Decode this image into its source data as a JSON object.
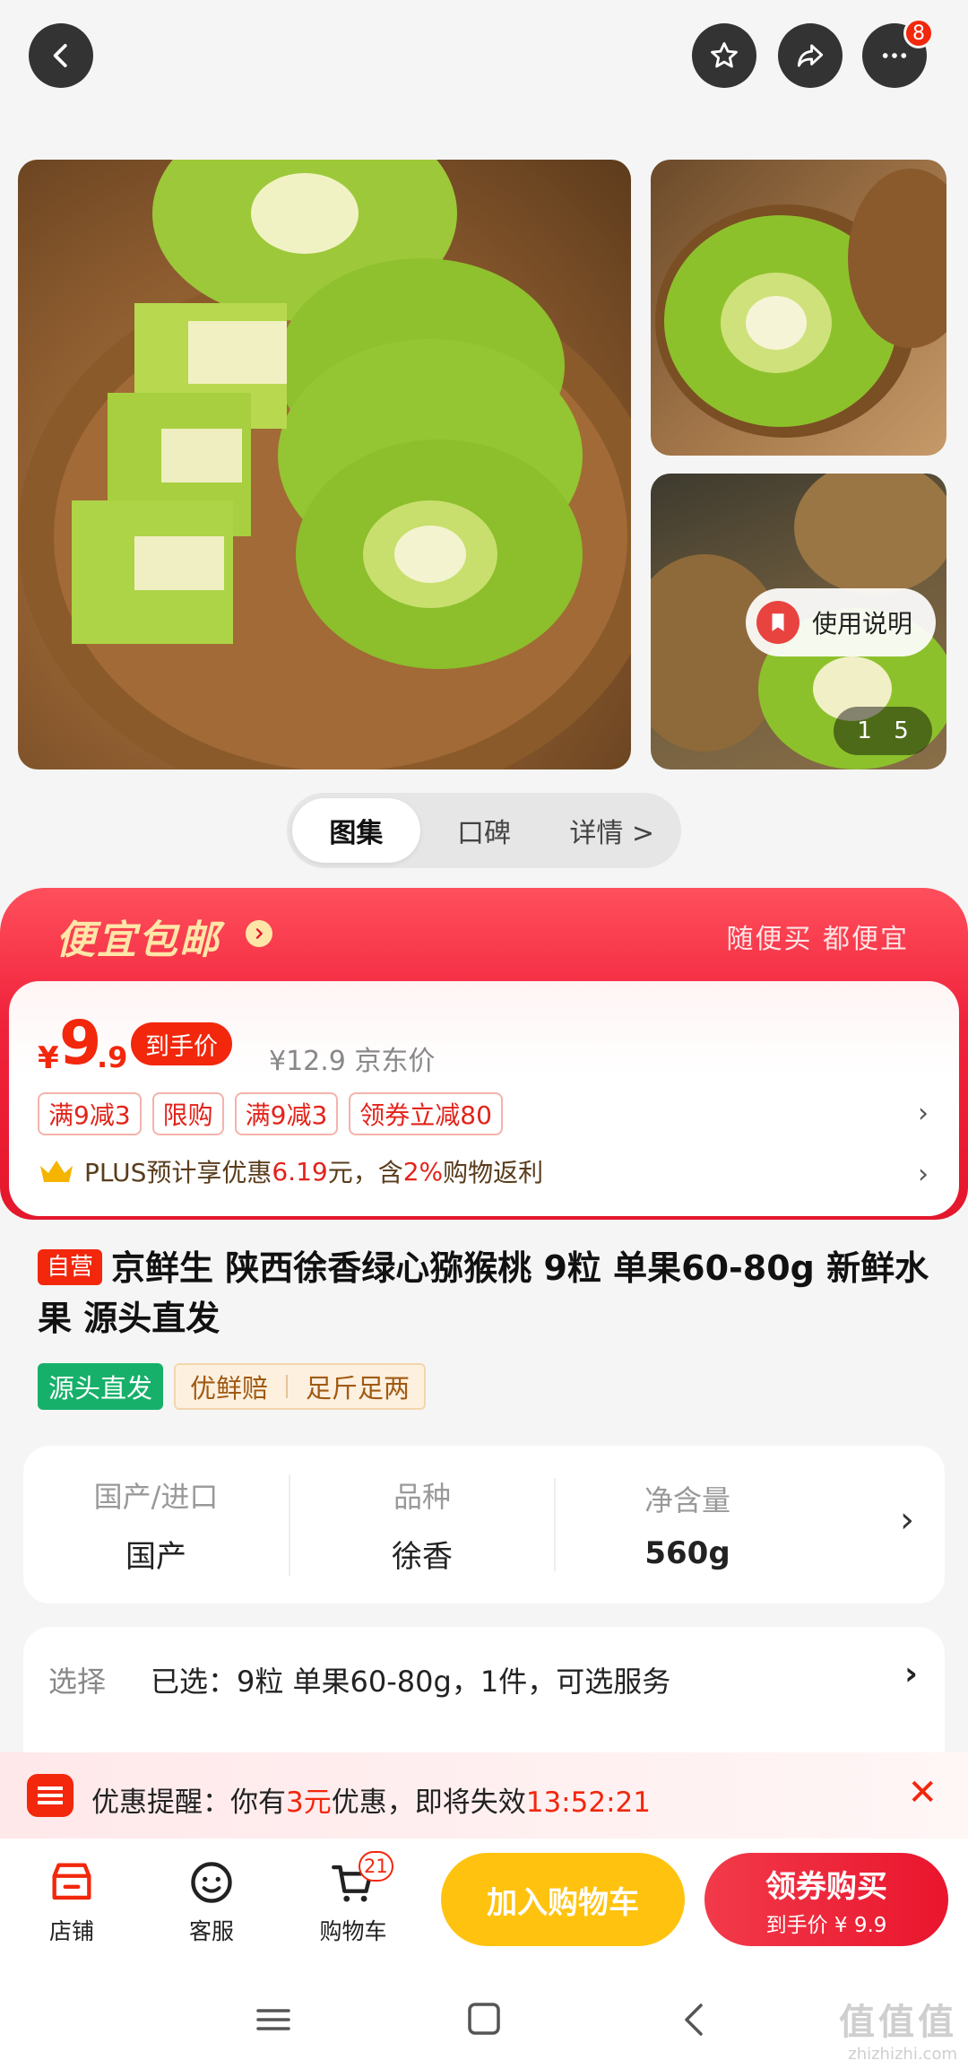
{
  "topbar": {
    "back_icon": "chevron-left-icon",
    "favorite_icon": "star-icon",
    "share_icon": "share-icon",
    "more_icon": "more-dots-icon",
    "more_badge": "8"
  },
  "gallery": {
    "guide_label": "使用说明",
    "pager_current": "1",
    "pager_total": "5"
  },
  "tabs": [
    {
      "label": "图集",
      "active": true
    },
    {
      "label": "口碑",
      "active": false
    },
    {
      "label": "详情 >",
      "active": false
    }
  ],
  "promo": {
    "title": "便宜包邮",
    "slogan": "随便买 都便宜",
    "currency": "¥",
    "price_int": "9",
    "price_dec": ".9",
    "hand_price_label": "到手价",
    "jd_price": "¥12.9 京东价",
    "tags": [
      "满9减3",
      "限购",
      "满9减3",
      "领券立减80"
    ],
    "plus_prefix": "PLUS预计享优惠",
    "plus_amount": "6.19",
    "plus_mid": "元，含",
    "plus_rate": "2%",
    "plus_suffix": "购物返利"
  },
  "product": {
    "self_label": "自营",
    "title": "京鲜生 陕西徐香绿心猕猴桃 9粒 单果60-80g 新鲜水果 源头直发",
    "feature_green": "源头直发",
    "feature_cream": [
      "优鲜赔",
      "足斤足两"
    ]
  },
  "attributes": [
    {
      "key": "国产/进口",
      "value": "国产"
    },
    {
      "key": "品种",
      "value": "徐香"
    },
    {
      "key": "净含量",
      "value": "560g"
    }
  ],
  "selection": {
    "key": "选择",
    "value": "已选：9粒 单果60-80g，1件，可选服务"
  },
  "reminder": {
    "prefix": "优惠提醒：你有",
    "amount": "3元",
    "mid": "优惠，即将失效",
    "countdown": "13:52:21"
  },
  "bottombar": {
    "shop_label": "店铺",
    "service_label": "客服",
    "cart_label": "购物车",
    "cart_count": "21",
    "add_cart_label": "加入购物车",
    "buy_label": "领券购买",
    "buy_sub": "到手价 ¥ 9.9"
  },
  "watermark": {
    "text": "值值值",
    "url": "zhizhizhi.com"
  },
  "colors": {
    "accent": "#f2270c",
    "promo_red": "#e4172c",
    "cart_yellow": "#ffc30f",
    "green_tag": "#16b06a"
  }
}
